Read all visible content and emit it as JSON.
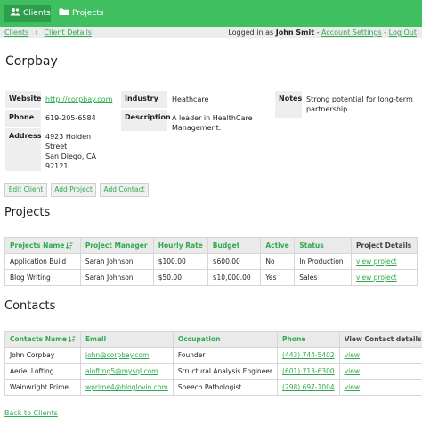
{
  "nav": {
    "items": [
      {
        "label": "Clients",
        "icon": "users-icon"
      },
      {
        "label": "Projects",
        "icon": "folder-icon"
      }
    ],
    "colors": {
      "bar": "#3fbf5f",
      "active": "#2e9e4c",
      "link": "#2eaa4f"
    }
  },
  "breadcrumb": [
    "Clients",
    "Client Details"
  ],
  "user": {
    "prefix": "Logged in as",
    "name": "John Smit",
    "separator": "-",
    "account_settings": "Account Settings",
    "logout": "Log Out"
  },
  "client": {
    "name": "Corpbay",
    "website_label": "Website",
    "website": "http://corpbay.com",
    "phone_label": "Phone",
    "phone": "619-205-6584",
    "address_label": "Address",
    "address_lines": [
      "4923 Holden",
      "Street",
      "San Diego, CA",
      "92121"
    ],
    "industry_label": "Industry",
    "industry": "Heathcare",
    "description_label": "Description",
    "description_lines": [
      "A leader in HealthCare",
      "Management."
    ],
    "notes_label": "Notes",
    "notes_lines": [
      "Strong potential for long-term",
      "partnership."
    ]
  },
  "actions": {
    "edit": "Edit Client",
    "add_project": "Add Project",
    "add_contact": "Add Contact"
  },
  "projects": {
    "heading": "Projects",
    "columns": [
      "Projects Name",
      "Project Manager",
      "Hourly Rate",
      "Budget",
      "Active",
      "Status",
      "Project Details"
    ],
    "rows": [
      [
        "Application Build",
        "Sarah Johnson",
        "$100.00",
        "$600.00",
        "No",
        "In Production",
        "view project"
      ],
      [
        "Blog Writing",
        "Sarah Johnson",
        "$50.00",
        "$10,000.00",
        "Yes",
        "Sales",
        "view project"
      ]
    ]
  },
  "contacts": {
    "heading": "Contacts",
    "columns": [
      "Contacts Name",
      "Email",
      "Occupation",
      "Phone",
      "View Contact details"
    ],
    "rows": [
      [
        "John Corpbay",
        "john@corpbay.com",
        "Founder",
        "(443) 744-5402",
        "view"
      ],
      [
        "Aeriel Lofting",
        "alofting5@mysql.com",
        "Structural Analysis Engineer",
        "(601) 713-6300",
        "view"
      ],
      [
        "Wainwright Prime",
        "wprime4@bloglovin.com",
        "Speech Pathologist",
        "(298) 697-1004",
        "view"
      ]
    ]
  },
  "back_link": "Back to Clients"
}
